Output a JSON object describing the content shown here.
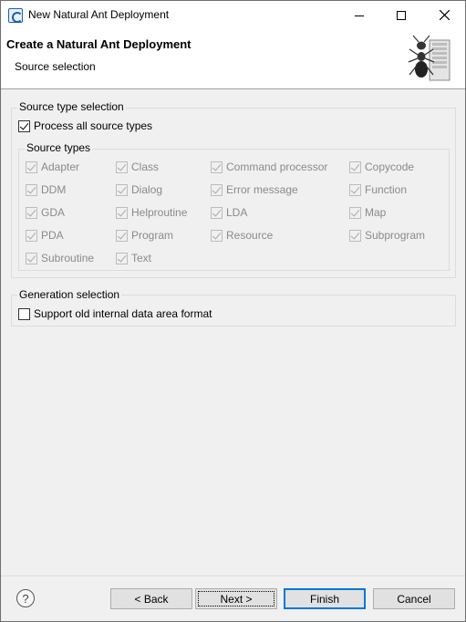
{
  "window": {
    "title": "New Natural Ant Deployment",
    "icons": [
      "app-icon",
      "minimize-icon",
      "maximize-icon",
      "close-icon"
    ]
  },
  "banner": {
    "title": "Create a Natural Ant Deployment",
    "subtitle": "Source selection",
    "image": "ant-server-icon"
  },
  "source_type_selection": {
    "label": "Source type selection",
    "process_all": {
      "label": "Process all source types",
      "checked": true
    },
    "source_types": {
      "label": "Source types",
      "items": [
        {
          "label": "Adapter",
          "checked": true,
          "enabled": false
        },
        {
          "label": "Class",
          "checked": true,
          "enabled": false
        },
        {
          "label": "Command processor",
          "checked": true,
          "enabled": false
        },
        {
          "label": "Copycode",
          "checked": true,
          "enabled": false
        },
        {
          "label": "DDM",
          "checked": true,
          "enabled": false
        },
        {
          "label": "Dialog",
          "checked": true,
          "enabled": false
        },
        {
          "label": "Error message",
          "checked": true,
          "enabled": false
        },
        {
          "label": "Function",
          "checked": true,
          "enabled": false
        },
        {
          "label": "GDA",
          "checked": true,
          "enabled": false
        },
        {
          "label": "Helproutine",
          "checked": true,
          "enabled": false
        },
        {
          "label": "LDA",
          "checked": true,
          "enabled": false
        },
        {
          "label": "Map",
          "checked": true,
          "enabled": false
        },
        {
          "label": "PDA",
          "checked": true,
          "enabled": false
        },
        {
          "label": "Program",
          "checked": true,
          "enabled": false
        },
        {
          "label": "Resource",
          "checked": true,
          "enabled": false
        },
        {
          "label": "Subprogram",
          "checked": true,
          "enabled": false
        },
        {
          "label": "Subroutine",
          "checked": true,
          "enabled": false
        },
        {
          "label": "Text",
          "checked": true,
          "enabled": false
        }
      ]
    }
  },
  "generation_selection": {
    "label": "Generation selection",
    "support_old": {
      "label": "Support old internal data area format",
      "checked": false
    }
  },
  "footer": {
    "help_icon": "help-icon",
    "help_glyph": "?",
    "back_label": "< Back",
    "next_label": "Next >",
    "finish_label": "Finish",
    "cancel_label": "Cancel"
  }
}
